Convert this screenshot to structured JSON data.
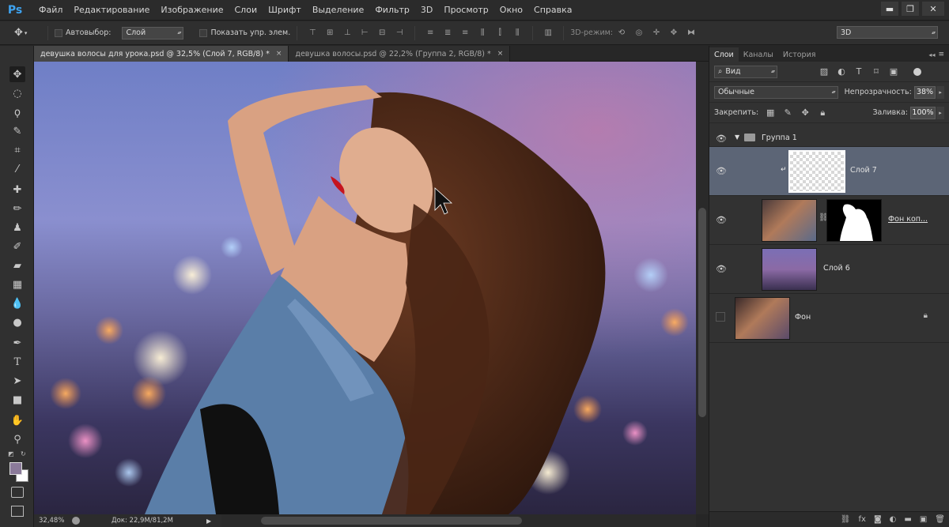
{
  "app": {
    "logo": "Ps",
    "menu": [
      "Файл",
      "Редактирование",
      "Изображение",
      "Слои",
      "Шрифт",
      "Выделение",
      "Фильтр",
      "3D",
      "Просмотр",
      "Окно",
      "Справка"
    ],
    "window_controls": [
      "▬",
      "❐",
      "✕"
    ]
  },
  "options": {
    "autoselect_label": "Автовыбор:",
    "autoselect_value": "Слой",
    "show_controls_label": "Показать упр. элем.",
    "mode3d_label": "3D-режим:",
    "workspace_value": "3D"
  },
  "tabs": [
    {
      "label": "девушка волосы для урока.psd @ 32,5% (Слой 7, RGB/8) *",
      "close": "×"
    },
    {
      "label": "девушка волосы.psd @ 22,2% (Группа 2, RGB/8) *",
      "close": "×"
    }
  ],
  "status": {
    "zoom": "32,48%",
    "doc_info": "Док: 22,9M/81,2M"
  },
  "panel": {
    "tabs": [
      "Слои",
      "Каналы",
      "История"
    ],
    "filter_kind": "Вид",
    "blend_mode": "Обычные",
    "opacity_label": "Непрозрачность:",
    "opacity_value": "38%",
    "lock_label": "Закрепить:",
    "fill_label": "Заливка:",
    "fill_value": "100%",
    "layers": [
      {
        "name": "Группа 1",
        "type": "group",
        "visible": true
      },
      {
        "name": "Слой 7",
        "type": "layer",
        "visible": true,
        "selected": true
      },
      {
        "name": "Фон коп...",
        "type": "masked",
        "visible": true
      },
      {
        "name": "Слой 6",
        "type": "layer",
        "visible": true
      },
      {
        "name": "Фон",
        "type": "background",
        "visible": false,
        "locked": true
      }
    ]
  },
  "icons": {
    "move_tool": "move-icon",
    "marquee": "marquee-icon",
    "lasso": "lasso-icon",
    "quick_select": "quick-select-icon",
    "crop": "crop-icon",
    "eyedropper": "eyedropper-icon",
    "healing": "healing-icon",
    "brush": "brush-icon",
    "stamp": "stamp-icon",
    "history_brush": "history-brush-icon",
    "eraser": "eraser-icon",
    "gradient": "gradient-icon",
    "blur": "blur-icon",
    "dodge": "dodge-icon",
    "pen": "pen-icon",
    "type": "type-icon",
    "path_select": "path-select-icon",
    "shape": "shape-icon",
    "hand": "hand-icon",
    "zoom": "zoom-icon"
  },
  "colors": {
    "foreground": "#8b7a9a",
    "background": "#ffffff",
    "accent": "#3ea3f0",
    "selected_layer": "#5c6576"
  }
}
